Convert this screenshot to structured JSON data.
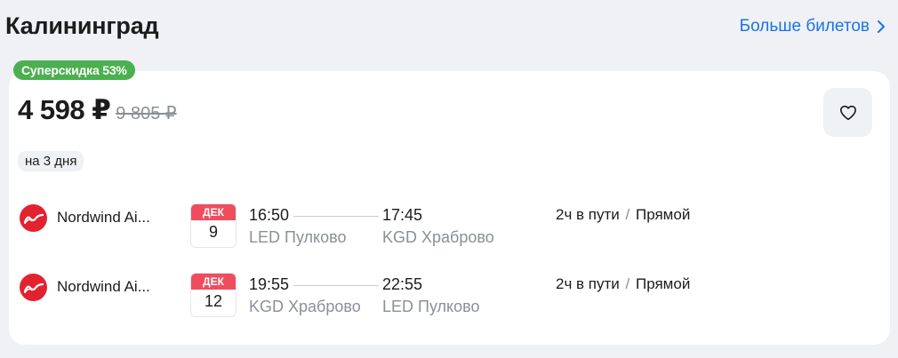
{
  "header": {
    "title": "Калининград",
    "more_label": "Больше билетов"
  },
  "offer": {
    "badge": "Суперскидка 53%",
    "price": "4 598 ₽",
    "old_price": "9 805 ₽",
    "duration": "на 3 дня"
  },
  "segments": [
    {
      "airline": "Nordwind Ai...",
      "month": "ДЕК",
      "day": "9",
      "dep_time": "16:50",
      "arr_time": "17:45",
      "dep_airport": "LED Пулково",
      "arr_airport": "KGD Храброво",
      "travel_time": "2ч в пути",
      "separator": "/",
      "stops": "Прямой"
    },
    {
      "airline": "Nordwind Ai...",
      "month": "ДЕК",
      "day": "12",
      "dep_time": "19:55",
      "arr_time": "22:55",
      "dep_airport": "KGD Храброво",
      "arr_airport": "LED Пулково",
      "travel_time": "2ч в пути",
      "separator": "/",
      "stops": "Прямой"
    }
  ],
  "icons": {
    "more": "chevron-right-icon",
    "favorite": "heart-icon",
    "airline_logo": "nordwind-logo-icon"
  },
  "colors": {
    "accent": "#1a73e8",
    "badge": "#4caf50",
    "calendar": "#ef4d5e",
    "airline": "#e2232f"
  }
}
